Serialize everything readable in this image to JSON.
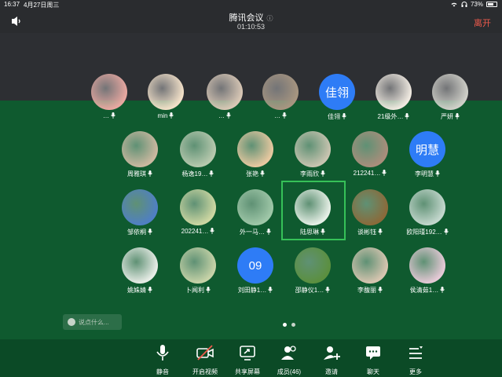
{
  "status_bar": {
    "time": "16:37",
    "date": "4月27日周三",
    "battery": "73%",
    "battery_level": 0.73
  },
  "header": {
    "title": "腾讯会议",
    "duration": "01:10:53",
    "leave_label": "离开"
  },
  "participants_row0": [
    {
      "name": "…",
      "avatar": "photo",
      "color": "#e8a7a0"
    },
    {
      "name": "min",
      "avatar": "photo",
      "color": "#f2e0c8"
    },
    {
      "name": "…",
      "avatar": "photo",
      "color": "#d8c7b5"
    },
    {
      "name": "…",
      "avatar": "photo",
      "color": "#a79580"
    },
    {
      "name": "佳翎",
      "avatar": "text"
    },
    {
      "name": "21级外…",
      "avatar": "photo",
      "color": "#efe9e0"
    },
    {
      "name": "严妍",
      "avatar": "photo",
      "color": "#cfcfc8"
    }
  ],
  "participants": [
    {
      "name": "周雅琪",
      "color": "#cbb8a0"
    },
    {
      "name": "杨逸19…",
      "color": "#b7c9ae"
    },
    {
      "name": "张艳",
      "color": "#e7c8a0"
    },
    {
      "name": "李雨欣",
      "color": "#c8c4b0"
    },
    {
      "name": "212241…",
      "color": "#a98e7b"
    },
    {
      "name": "李明慧",
      "avatar_text": "明慧"
    },
    {
      "name": "邹依桐",
      "color": "#4f7fc4"
    },
    {
      "name": "202241…",
      "color": "#cdd7a2"
    },
    {
      "name": "外一马…",
      "color": "#9fc7a8"
    },
    {
      "name": "陆思琳",
      "color": "#e6efe6"
    },
    {
      "name": "谈彬钰",
      "color": "#8a6a3a"
    },
    {
      "name": "欧阳瑾192…",
      "color": "#c3d7cd"
    },
    {
      "name": "姚姝婧",
      "color": "#e7ece6"
    },
    {
      "name": "卜闻利",
      "color": "#c7d3a8"
    },
    {
      "name": "刘田静1…",
      "avatar_text": "09"
    },
    {
      "name": "邵静仪1…",
      "color": "#5b8f3f"
    },
    {
      "name": "李馥丽",
      "color": "#d7c5b0"
    },
    {
      "name": "侯清茹1…",
      "color": "#e5c9d6"
    }
  ],
  "chat": {
    "placeholder": "说点什么..."
  },
  "toolbar": [
    {
      "label": "静音",
      "icon": "microphone-icon"
    },
    {
      "label": "开启视频",
      "icon": "camera-off-icon"
    },
    {
      "label": "共享屏幕",
      "icon": "share-screen-icon"
    },
    {
      "label": "成员(46)",
      "icon": "members-icon"
    },
    {
      "label": "邀请",
      "icon": "invite-icon"
    },
    {
      "label": "聊天",
      "icon": "chat-icon"
    },
    {
      "label": "更多",
      "icon": "more-icon"
    }
  ],
  "colors": {
    "accent_green": "#36c158",
    "leave_red": "#ef5a4c",
    "avatar_blue": "#2e7cf6"
  }
}
